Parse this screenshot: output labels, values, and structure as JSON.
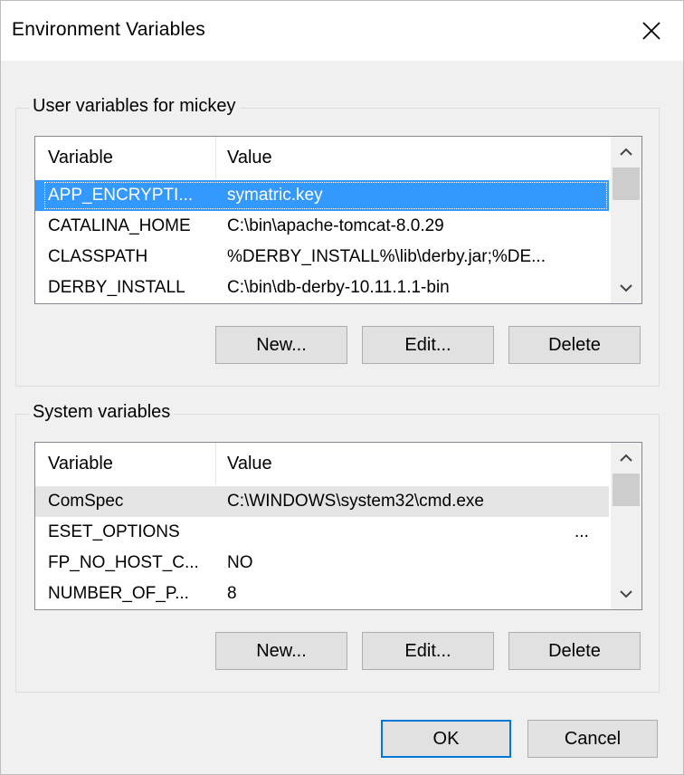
{
  "window": {
    "title": "Environment Variables"
  },
  "user_group": {
    "legend": "User variables for mickey",
    "columns": {
      "variable": "Variable",
      "value": "Value"
    },
    "rows": [
      {
        "variable": "APP_ENCRYPTI...",
        "value": "symatric.key"
      },
      {
        "variable": "CATALINA_HOME",
        "value": "C:\\bin\\apache-tomcat-8.0.29"
      },
      {
        "variable": "CLASSPATH",
        "value": "%DERBY_INSTALL%\\lib\\derby.jar;%DE..."
      },
      {
        "variable": "DERBY_INSTALL",
        "value": "C:\\bin\\db-derby-10.11.1.1-bin"
      }
    ],
    "buttons": {
      "new": "New...",
      "edit": "Edit...",
      "delete": "Delete"
    }
  },
  "system_group": {
    "legend": "System variables",
    "columns": {
      "variable": "Variable",
      "value": "Value"
    },
    "rows": [
      {
        "variable": "ComSpec",
        "value": "C:\\WINDOWS\\system32\\cmd.exe"
      },
      {
        "variable": "ESET_OPTIONS",
        "value": "..."
      },
      {
        "variable": "FP_NO_HOST_C...",
        "value": "NO"
      },
      {
        "variable": "NUMBER_OF_P...",
        "value": "8"
      }
    ],
    "buttons": {
      "new": "New...",
      "edit": "Edit...",
      "delete": "Delete"
    }
  },
  "footer": {
    "ok": "OK",
    "cancel": "Cancel"
  },
  "colors": {
    "selection": "#3399ff",
    "accent_border": "#0078d7",
    "dialog_bg": "#f0f0f0"
  },
  "icons": {
    "close": "close-icon",
    "scroll_up": "chevron-up-icon",
    "scroll_down": "chevron-down-icon"
  }
}
